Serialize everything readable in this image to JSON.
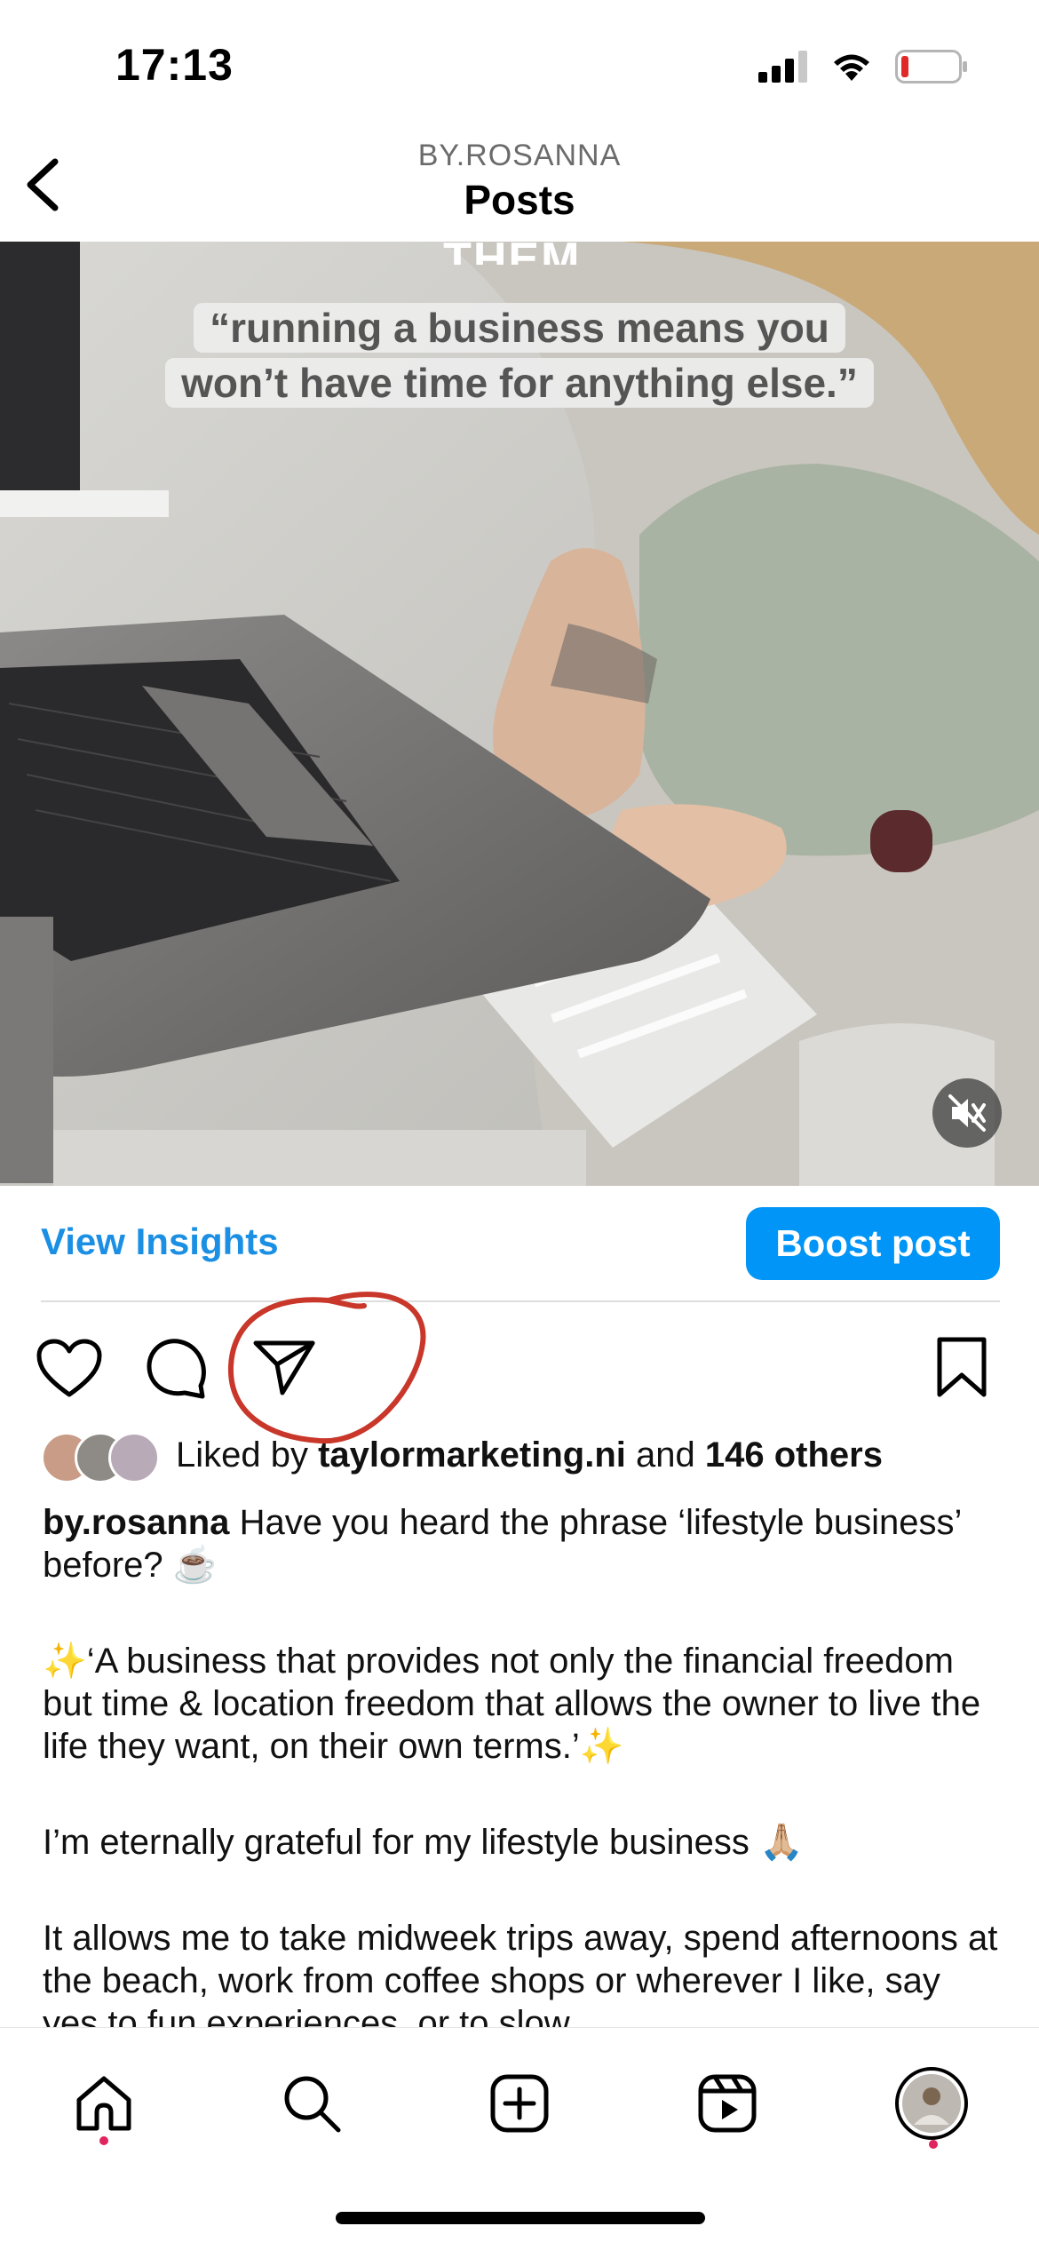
{
  "status_bar": {
    "time": "17:13",
    "icons": [
      "cellular-signal-icon",
      "wifi-icon",
      "battery-low-icon"
    ]
  },
  "header": {
    "account": "BY.ROSANNA",
    "title": "Posts",
    "back_icon": "chevron-left-icon"
  },
  "media": {
    "top_caption": "THEM.",
    "quote_line_1": "“running a business means you",
    "quote_line_2": "won’t have time for anything else.”",
    "mute_icon": "speaker-muted-icon"
  },
  "insights_row": {
    "view_insights": "View Insights",
    "boost_post": "Boost post"
  },
  "actions": {
    "icons": [
      "heart-icon",
      "comment-icon",
      "share-icon",
      "bookmark-icon"
    ]
  },
  "likes": {
    "prefix": "Liked by",
    "user": "taylormarketing.ni",
    "conjunction": "and",
    "others": "146 others"
  },
  "caption": {
    "username": "by.rosanna",
    "paragraph_1": "Have you heard the phrase ‘lifestyle business’ before? ☕️",
    "paragraph_2": "✨‘A business that provides not only the financial freedom but time & location freedom that allows the owner to live the life they want, on their own terms.’✨",
    "paragraph_3": "I’m eternally grateful for my lifestyle business 🙏🏼",
    "paragraph_4": "It allows me to take midweek trips away, spend afternoons at the beach, work from coffee shops or wherever I like, say yes to fun experiences, or to slow"
  },
  "bottom_nav": {
    "items": [
      "home-icon",
      "search-icon",
      "create-post-icon",
      "reels-icon",
      "profile-avatar"
    ]
  },
  "colors": {
    "accent_blue": "#0095f6",
    "link_blue": "#1a8fe3",
    "annotation_red": "#c8372a",
    "notification_dot": "#e0245e"
  }
}
